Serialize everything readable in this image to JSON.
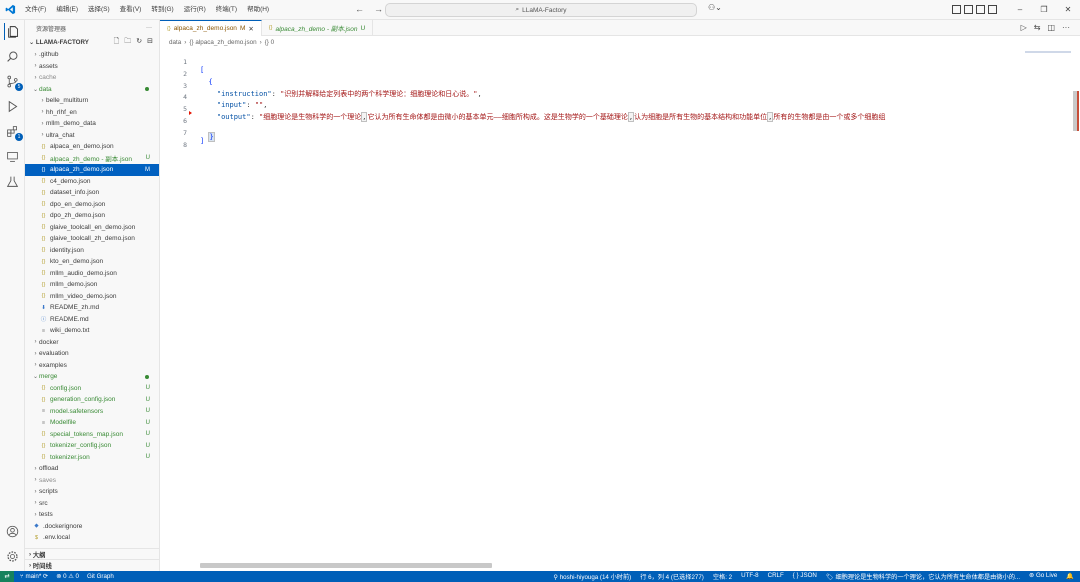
{
  "menu": [
    "文件(F)",
    "编辑(E)",
    "选择(S)",
    "查看(V)",
    "转到(G)",
    "运行(R)",
    "终端(T)",
    "帮助(H)"
  ],
  "search": {
    "label": "LLaMA-Factory"
  },
  "sidebar": {
    "title": "资源管理器",
    "more": "···",
    "root": "LLAMA-FACTORY",
    "tree": [
      {
        "name": ".github",
        "type": "folder",
        "indent": 1
      },
      {
        "name": "assets",
        "type": "folder",
        "indent": 1
      },
      {
        "name": "cache",
        "type": "folder",
        "indent": 1,
        "style": "grey"
      },
      {
        "name": "data",
        "type": "folder-open",
        "indent": 1,
        "style": "green",
        "dot": true
      },
      {
        "name": "belle_multiturn",
        "type": "folder",
        "indent": 2
      },
      {
        "name": "hh_rlhf_en",
        "type": "folder",
        "indent": 2
      },
      {
        "name": "mllm_demo_data",
        "type": "folder",
        "indent": 2
      },
      {
        "name": "ultra_chat",
        "type": "folder",
        "indent": 2
      },
      {
        "name": "alpaca_en_demo.json",
        "type": "json",
        "indent": 2
      },
      {
        "name": "alpaca_zh_demo - 副本.json",
        "type": "json",
        "indent": 2,
        "style": "green",
        "status": "U"
      },
      {
        "name": "alpaca_zh_demo.json",
        "type": "json",
        "indent": 2,
        "status": "M",
        "selected": true
      },
      {
        "name": "c4_demo.json",
        "type": "json",
        "indent": 2
      },
      {
        "name": "dataset_info.json",
        "type": "json",
        "indent": 2
      },
      {
        "name": "dpo_en_demo.json",
        "type": "json",
        "indent": 2
      },
      {
        "name": "dpo_zh_demo.json",
        "type": "json",
        "indent": 2
      },
      {
        "name": "glaive_toolcall_en_demo.json",
        "type": "json",
        "indent": 2
      },
      {
        "name": "glaive_toolcall_zh_demo.json",
        "type": "json",
        "indent": 2
      },
      {
        "name": "identity.json",
        "type": "json",
        "indent": 2
      },
      {
        "name": "kto_en_demo.json",
        "type": "json",
        "indent": 2
      },
      {
        "name": "mllm_audio_demo.json",
        "type": "json",
        "indent": 2
      },
      {
        "name": "mllm_demo.json",
        "type": "json",
        "indent": 2
      },
      {
        "name": "mllm_video_demo.json",
        "type": "json",
        "indent": 2
      },
      {
        "name": "README_zh.md",
        "type": "md",
        "indent": 2
      },
      {
        "name": "README.md",
        "type": "info",
        "indent": 2
      },
      {
        "name": "wiki_demo.txt",
        "type": "txt",
        "indent": 2
      },
      {
        "name": "docker",
        "type": "folder",
        "indent": 1
      },
      {
        "name": "evaluation",
        "type": "folder",
        "indent": 1
      },
      {
        "name": "examples",
        "type": "folder",
        "indent": 1
      },
      {
        "name": "merge",
        "type": "folder-open",
        "indent": 1,
        "style": "green",
        "dot": true
      },
      {
        "name": "config.json",
        "type": "json",
        "indent": 2,
        "style": "green",
        "status": "U"
      },
      {
        "name": "generation_config.json",
        "type": "json",
        "indent": 2,
        "style": "green",
        "status": "U"
      },
      {
        "name": "model.safetensors",
        "type": "txt",
        "indent": 2,
        "style": "green",
        "status": "U"
      },
      {
        "name": "Modelfile",
        "type": "txt",
        "indent": 2,
        "style": "green",
        "status": "U"
      },
      {
        "name": "special_tokens_map.json",
        "type": "json",
        "indent": 2,
        "style": "green",
        "status": "U"
      },
      {
        "name": "tokenizer_config.json",
        "type": "json",
        "indent": 2,
        "style": "green",
        "status": "U"
      },
      {
        "name": "tokenizer.json",
        "type": "json",
        "indent": 2,
        "style": "green",
        "status": "U"
      },
      {
        "name": "offload",
        "type": "folder",
        "indent": 1
      },
      {
        "name": "saves",
        "type": "folder",
        "indent": 1,
        "style": "grey"
      },
      {
        "name": "scripts",
        "type": "folder",
        "indent": 1
      },
      {
        "name": "src",
        "type": "folder",
        "indent": 1
      },
      {
        "name": "tests",
        "type": "folder",
        "indent": 1
      },
      {
        "name": ".dockerignore",
        "type": "docker",
        "indent": 1
      },
      {
        "name": ".env.local",
        "type": "env",
        "indent": 1
      }
    ],
    "outline": "大纲",
    "timeline": "时间线"
  },
  "tabs": [
    {
      "label": "alpaca_zh_demo.json",
      "status": "M",
      "active": true
    },
    {
      "label": "alpaca_zh_demo - 副本.json",
      "status": "U",
      "active": false
    }
  ],
  "breadcrumb": [
    "data",
    "{} alpaca_zh_demo.json",
    "{} 0"
  ],
  "code": {
    "line_numbers": [
      "1",
      "2",
      "3",
      "4",
      "5",
      "6",
      "7",
      "8"
    ],
    "l1": "[",
    "l2": "{",
    "l3_key": "\"instruction\"",
    "l3_val": "\"识别并解释给定列表中的两个科学理论：细胞理论和日心说。\"",
    "l4_key": "\"input\"",
    "l4_val": "\"\"",
    "l5_key": "\"output\"",
    "l5_a": "\"细胞理论是生物科学的一个理论",
    "l5_b": "它认为所有生命体都是由微小的基本单元——细胞所构成。这是生物学的一个基础理论",
    "l5_c": "认为细胞是所有生物的基本结构和功能单位",
    "l5_d": "所有的生物都是由一个或多个细胞组",
    "l6": "}",
    "l7": "]"
  },
  "status": {
    "branch": "main*",
    "sync": "⟳",
    "problems": "⊗ 0 ⚠ 0",
    "git_graph": "Git Graph",
    "author": "hoshi-hiyouga (14 小时前)",
    "position": "行 6，列 4 (已选择277)",
    "spaces": "空格: 2",
    "encoding": "UTF-8",
    "eol": "CRLF",
    "language": "{ } JSON",
    "preview": "细胞理论是生物科学的一个理论，它认为所有生命体都是由微小的...",
    "golive": "Go Live"
  }
}
